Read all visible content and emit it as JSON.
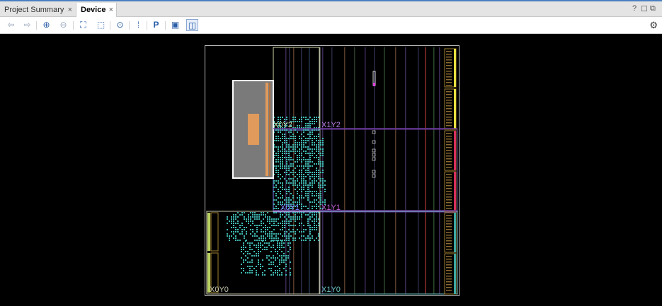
{
  "tabs": [
    {
      "label": "Project Summary",
      "active": false
    },
    {
      "label": "Device",
      "active": true
    }
  ],
  "tab_close_glyph": "×",
  "window_controls": [
    "?",
    "☐",
    "⧉"
  ],
  "toolbar": {
    "buttons": [
      {
        "name": "back-arrow-icon",
        "glyph": "⇦"
      },
      {
        "name": "forward-arrow-icon",
        "glyph": "⇨"
      },
      {
        "name": "zoom-in-icon",
        "glyph": "⊕"
      },
      {
        "name": "zoom-out-icon",
        "glyph": "⊖"
      },
      {
        "name": "zoom-fit-icon",
        "glyph": "⛶"
      },
      {
        "name": "zoom-area-icon",
        "glyph": "⬚"
      },
      {
        "name": "auto-fit-selection-icon",
        "glyph": "⊙"
      },
      {
        "name": "show-routing-icon",
        "glyph": "⁞"
      },
      {
        "name": "place-icon",
        "glyph": "P"
      },
      {
        "name": "show-clock-regions-icon",
        "glyph": "▣"
      },
      {
        "name": "show-cells-icon",
        "glyph": "◫"
      }
    ],
    "settings_glyph": "⚙"
  },
  "device": {
    "clock_regions": [
      {
        "label": "X0Y2",
        "color": "#cfd9a8"
      },
      {
        "label": "X1Y2",
        "color": "#b77ee0"
      },
      {
        "label": "X0Y1",
        "color": "#7f7fff"
      },
      {
        "label": "X1Y1",
        "color": "#c45fd6"
      },
      {
        "label": "X0Y0",
        "color": "#c8c8b0"
      },
      {
        "label": "X1Y0",
        "color": "#6ec6c6"
      }
    ],
    "colors": {
      "logic_cells": "#3fb8b0",
      "selected_cell": "#7a7a7a",
      "selected_block": "#e09a5c",
      "io_yellow": "#e8e040",
      "io_red": "#d8305a",
      "io_teal": "#3ea8a0",
      "io_green": "#b8d060",
      "routing_purple": "#6a3a9a",
      "marker_magenta": "#e040e0"
    }
  }
}
